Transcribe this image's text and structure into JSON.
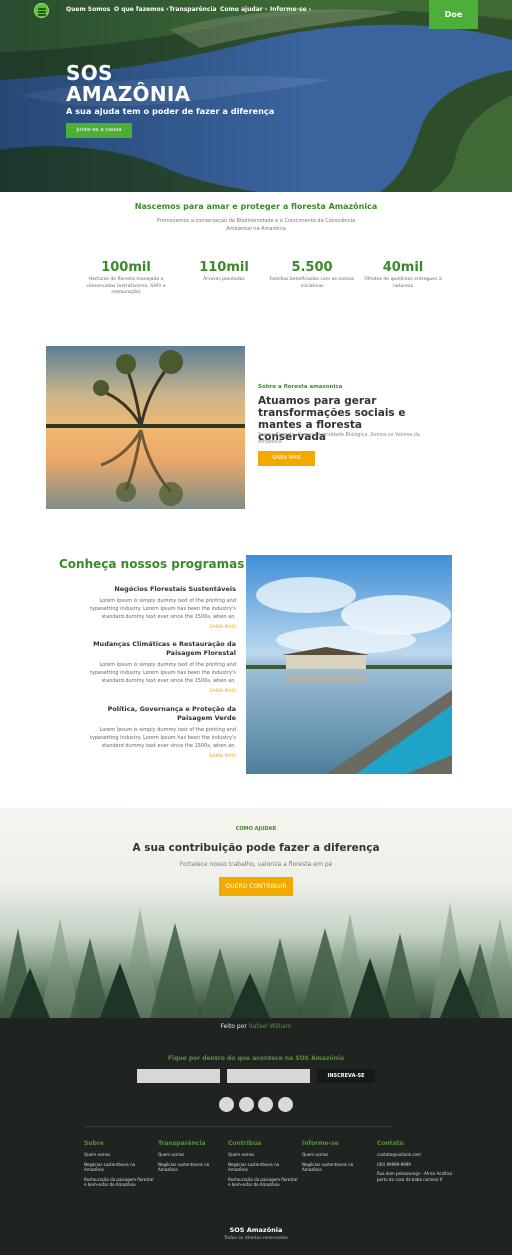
{
  "nav": {
    "items": [
      {
        "label": "Quem Somos"
      },
      {
        "label": "O que fazemos ›"
      },
      {
        "label": "Transparência"
      },
      {
        "label": "Como ajudar ›"
      },
      {
        "label": "Informe-se ›"
      }
    ],
    "donate_label": "Doe"
  },
  "hero": {
    "title_line1": "SOS",
    "title_line2": "AMAZÔNIA",
    "subtitle": "A sua ajuda tem o poder de fazer a diferença",
    "cta_label": "Junte-se a causa"
  },
  "mission": {
    "title": "Nascemos para amar e proteger a floresta Amazônica",
    "text": "Promovemos a conservação da Biodiversidade e o Crescimento da Consciência Ambiental na Amazônia",
    "stats": [
      {
        "value": "100mil",
        "label": "Hectares de floresta manejada e conservadas (extrativismo, SAFs e restauração)"
      },
      {
        "value": "110mil",
        "label": "Árvores plantadas"
      },
      {
        "value": "5.500",
        "label": "Famílias beneficiadas com as nossas iniciativas"
      },
      {
        "value": "40mil",
        "label": "Filhotes de quelônios entregues à natureza"
      }
    ]
  },
  "about": {
    "eyebrow": "Sobre a floresta amazonica",
    "title": "Atuamos para gerar transformações sociais e mantes a floresta conservada",
    "text": "Somos Floresta. Somos Diversidade Biológica. Somos os Valores da Amazonia",
    "button_label": "SAIBA MAIS"
  },
  "programs": {
    "title": "Conheça nossos programas",
    "items": [
      {
        "title": "Negócios Florestais Sustentáveis",
        "text": "Lorem Ipsum is simply dummy text of the printing and typesetting industry. Lorem Ipsum has been the industry's standard dummy text ever since the 1500s, when an.",
        "more": "SAIBA MAIS"
      },
      {
        "title": "Mudanças Climáticas e Restauração da Paisagem Florestal",
        "text": "Lorem Ipsum is simply dummy text of the printing and typesetting industry. Lorem Ipsum has been the industry's standard dummy text ever since the 1500s, when an.",
        "more": "SAIBA MAIS"
      },
      {
        "title": "Política, Governança e Proteção da Paisagem Verde",
        "text": "Lorem Ipsum is simply dummy text of the printing and typesetting industry. Lorem Ipsum has been the industry's standard dummy text ever since the 1500s, when an.",
        "more": "SAIBA MAIS"
      }
    ]
  },
  "contribute": {
    "eyebrow": "COMO AJUDAR",
    "title": "A sua contribuição pode fazer a diferença",
    "subtitle": "Fortalece nosso trabalho, valoriza a floresta em pé",
    "button_label": "QUERO CONTRIBUIR"
  },
  "footer": {
    "credit_prefix": "Feito por",
    "credit_author": "Rafael William",
    "newsletter_title": "Fique por dentro do que acontece na SOS Amazônia",
    "subscribe_label": "INSCREVA-SE",
    "columns": [
      {
        "title": "Sobre",
        "items": [
          "Quem somos",
          "Negócios sustentáveis na Amazônia",
          "Restauração da paisagem florestal e bem-estar da Amazônia"
        ]
      },
      {
        "title": "Transparência",
        "items": [
          "Quem somos",
          "Negócios sustentáveis na Amazônia"
        ]
      },
      {
        "title": "Contribua",
        "items": [
          "Quem somos",
          "Negócios sustentáveis na Amazônia",
          "Restauração da paisagem florestal e bem-estar da Amazônia"
        ]
      },
      {
        "title": "Informe-se",
        "items": [
          "Quem somos",
          "Negócios sustentáveis na Amazônia"
        ]
      },
      {
        "title": "Contato",
        "items": [
          "contato@outlook.com",
          "(00) 99999-9999",
          "Rua dom pelezzuregs - Africo Acoltico perto da casa da bobo numero 0"
        ]
      }
    ],
    "brand": "SOS Amazônia",
    "rights": "Todos os direitos reservados"
  },
  "colors": {
    "brand_green": "#3b8a2a",
    "button_green": "#4caf3a",
    "accent_yellow": "#f2a900",
    "footer_bg": "#1f2420"
  }
}
